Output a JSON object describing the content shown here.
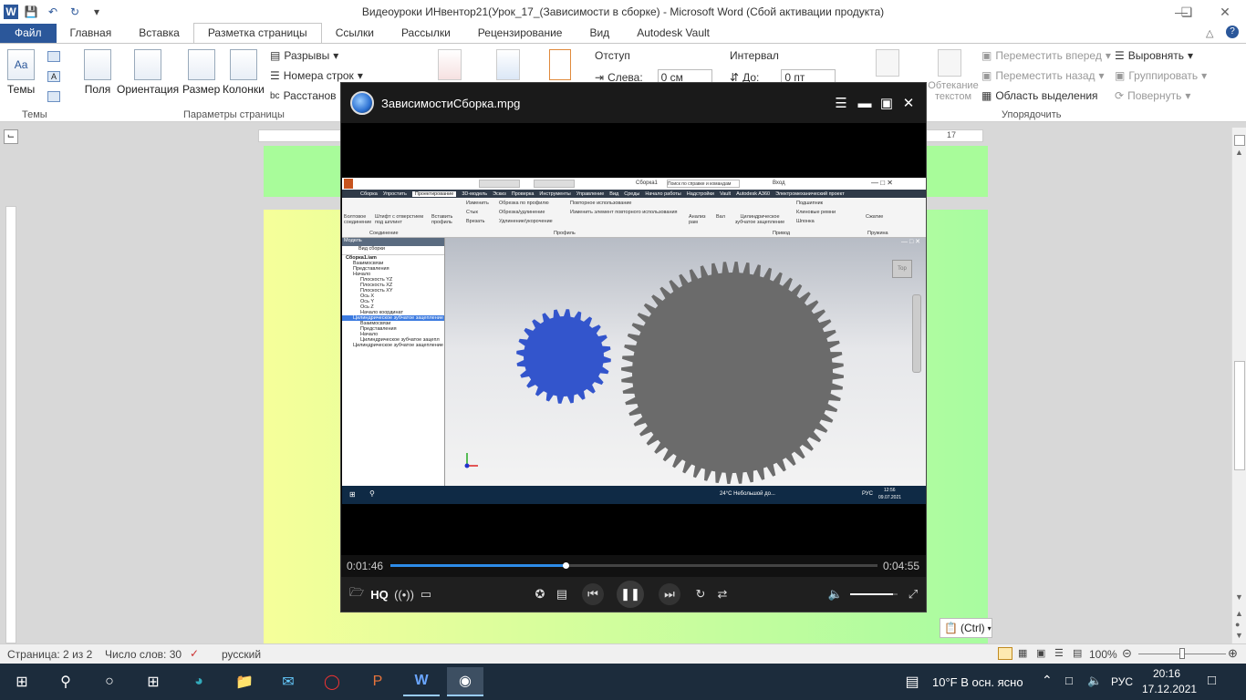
{
  "word": {
    "title": "Видеоуроки ИНвентор21(Урок_17_(Зависимости в сборке)  -  Microsoft Word (Сбой активации продукта)",
    "tabs": [
      "Файл",
      "Главная",
      "Вставка",
      "Разметка страницы",
      "Ссылки",
      "Рассылки",
      "Рецензирование",
      "Вид",
      "Autodesk Vault"
    ],
    "ribbon": {
      "themes": "Темы",
      "fields": "Поля",
      "orientation": "Ориентация",
      "size": "Размер",
      "columns": "Колонки",
      "breaks": "Разрывы",
      "line_numbers": "Номера строк",
      "hyphenation": "Расстанов",
      "page_setup_group": "Параметры страницы",
      "indent_label": "Отступ",
      "indent_left": "Слева:",
      "indent_left_value": "0 см",
      "spacing_label": "Интервал",
      "spacing_before": "До:",
      "spacing_before_value": "0 пт",
      "wrap_text": "Обтекание текстом",
      "bring_forward": "Переместить вперед",
      "send_backward": "Переместить назад",
      "selection_pane": "Область выделения",
      "align": "Выровнять",
      "group": "Группировать",
      "rotate": "Повернуть",
      "arrange_group": "Упорядочить",
      "themes_group": "Темы"
    },
    "ruler_mark": "17",
    "paste_options": "(Ctrl)",
    "status": {
      "page": "Страница: 2 из 2",
      "words": "Число слов: 30",
      "language": "русский",
      "zoom": "100%"
    }
  },
  "player": {
    "filename": "ЗависимостиСборка.mpg",
    "time_current": "0:01:46",
    "time_total": "0:04:55",
    "progress": 0.36,
    "volume": 0.9,
    "hq_label": "HQ"
  },
  "inventor": {
    "tabs": [
      "Сборка",
      "Упростить",
      "Проектирование",
      "3D-модель",
      "Эскиз",
      "Проверка",
      "Инструменты",
      "Управление",
      "Вид",
      "Среды",
      "Начало работы",
      "Надстройки",
      "Vault",
      "Autodesk A360",
      "Электромеханический проект"
    ],
    "title_doc": "Сборка1",
    "search_hint": "Поиск по справке и командам",
    "signin": "Вход",
    "ribbon_items": [
      "Болтовое соединение",
      "Штифт с отверстием под шплинт",
      "Вставить профиль",
      "Изменить",
      "Стык",
      "Врезать",
      "Обрезка по профилю",
      "Обрезка/удлинение",
      "Удлинение/укорочение",
      "Повторное использование",
      "Изменить элемент повторного использования",
      "Анализ рам",
      "Вал",
      "Цилиндрическое зубчатое зацепление",
      "Подшипник",
      "Клиновые ремни",
      "Шпонка",
      "Сжатие"
    ],
    "ribbon_groups": [
      "Соединение",
      "Профиль",
      "Привод",
      "Пружина"
    ],
    "browser_header": "Модель",
    "browser_view": "Вид сборки",
    "tree": [
      "Сборка1.iam",
      "Взаимосвязи",
      "Представления",
      "Начало",
      "Плоскость YZ",
      "Плоскость XZ",
      "Плоскость XY",
      "Ось X",
      "Ось Y",
      "Ось Z",
      "Начало координат",
      "Цилиндрическое зубчатое зацепление",
      "Взаимосвязи",
      "Представления",
      "Начало",
      "Цилиндрическое зубчатое зацепл",
      "Цилиндрическое зубчатое зацепление"
    ],
    "taskbar": {
      "weather": "24°C  Небольшой до...",
      "lang": "РУС",
      "time": "12:56",
      "date": "09.07.2021"
    },
    "viewcube": "Top",
    "gear_colors": {
      "small": "#3355cc",
      "large": "#6b6b6b"
    }
  },
  "taskbar": {
    "weather": "10°F  В осн. ясно",
    "lang": "РУС",
    "time": "20:16",
    "date": "17.12.2021"
  }
}
